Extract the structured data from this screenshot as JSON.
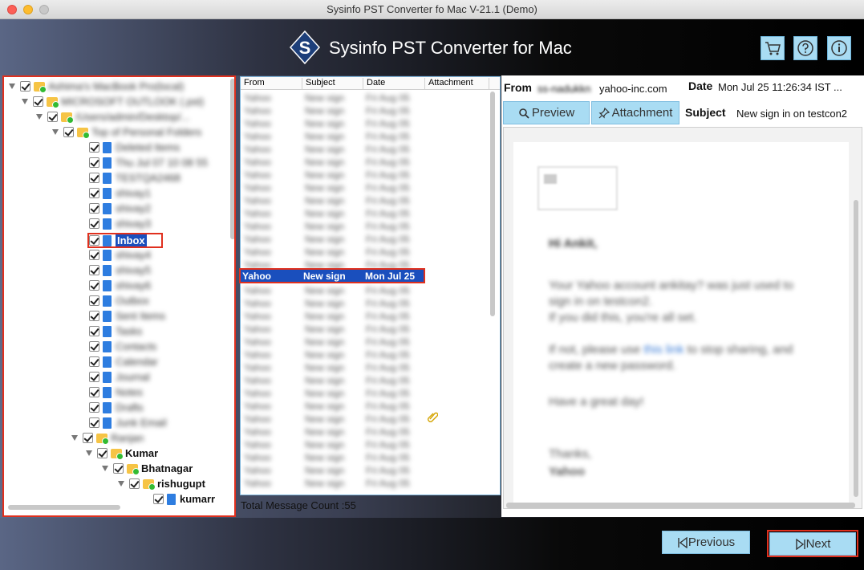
{
  "window": {
    "title": "Sysinfo PST Converter fo Mac V-21.1 (Demo)"
  },
  "header": {
    "brand": "Sysinfo PST Converter for Mac",
    "logo_letter": "S",
    "buttons": [
      "cart-icon",
      "help-icon",
      "info-icon"
    ]
  },
  "tree": {
    "blurred_rows": [
      "Ashima's MacBook Pro(local)",
      "MICROSOFT OUTLOOK (.pst)",
      "/Users/admin/Desktop/...",
      "Top of Personal Folders",
      "Deleted Items",
      "Thu Jul 07 10 08 55",
      "TESTQA2468",
      "shivay1",
      "shivay2",
      "shivay3",
      "shivay4",
      "shivay5",
      "shivay6",
      "Outbox",
      "Sent Items",
      "Tasks",
      "Contacts",
      "Calendar",
      "Journal",
      "Notes",
      "Drafts",
      "Junk Email",
      "Ranjan"
    ],
    "inbox_label": "Inbox",
    "kumar_label": "Kumar",
    "bhatnagar_label": "Bhatnagar",
    "rishugupta_label": "rishugupt",
    "kumarr_label": "kumarr"
  },
  "list": {
    "columns": {
      "from": "From",
      "subject": "Subject",
      "date": "Date",
      "attachment": "Attachment"
    },
    "selected": {
      "from": "Yahoo",
      "subject": "New sign",
      "date": "Mon Jul 25"
    },
    "count_label": "Total Message Count :55"
  },
  "preview": {
    "from_label": "From",
    "from_value": "yahoo-inc.com",
    "date_label": "Date",
    "date_value": "Mon Jul 25 11:26:34 IST ...",
    "subject_label": "Subject",
    "subject_value": "New sign in on testcon2",
    "tab_preview": "Preview",
    "tab_attachment": "Attachment"
  },
  "footer": {
    "previous": "Previous",
    "next": "Next"
  },
  "colors": {
    "accent": "#a9dcf3",
    "highlight": "#e0301e",
    "selection": "#1a4fbd"
  }
}
